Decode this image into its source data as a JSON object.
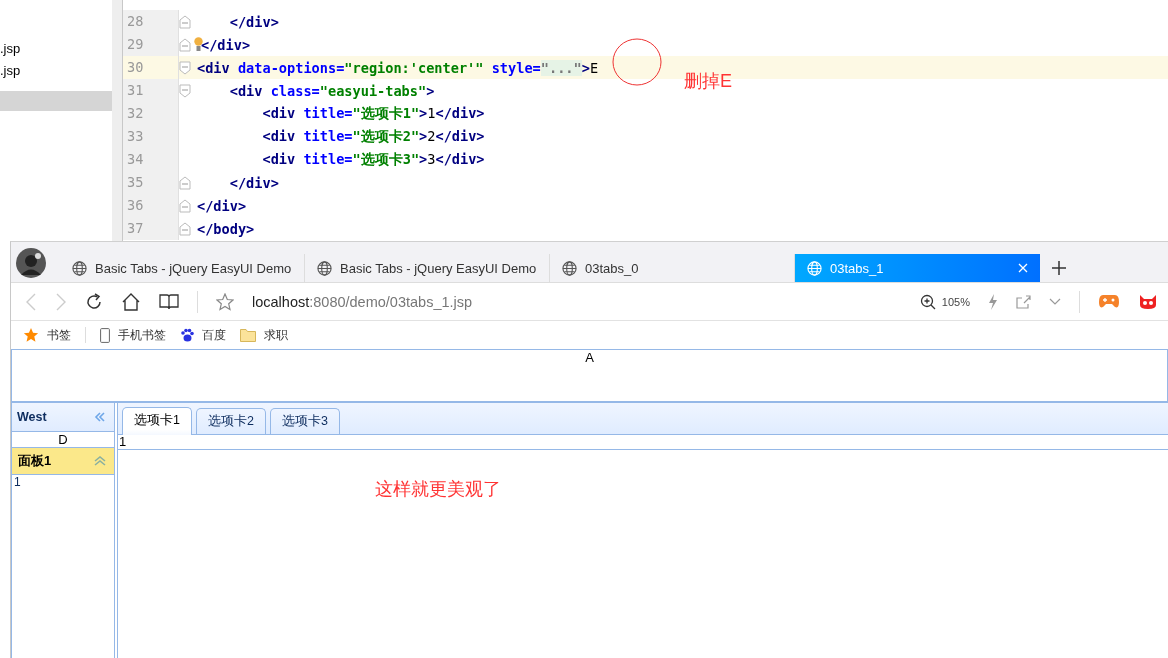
{
  "editor": {
    "files": [
      {
        "name": ".jsp"
      },
      {
        "name": ".jsp"
      }
    ],
    "lines": [
      {
        "number": "28",
        "fold_start": false,
        "fold_end": true,
        "bulb": false,
        "current": false,
        "tokens": [
          {
            "kind": "tag",
            "text": "    </div>"
          }
        ]
      },
      {
        "number": "29",
        "fold_start": false,
        "fold_end": true,
        "bulb": true,
        "current": false,
        "tokens": [
          {
            "kind": "tag",
            "text": "</div>"
          }
        ]
      },
      {
        "number": "30",
        "fold_start": true,
        "fold_end": false,
        "bulb": false,
        "current": true,
        "tokens": [
          {
            "kind": "tag",
            "text": "<div"
          },
          {
            "kind": "attr",
            "text": " data-options="
          },
          {
            "kind": "str",
            "text": "\"region:'center'\""
          },
          {
            "kind": "attr",
            "text": " style="
          },
          {
            "kind": "folded",
            "text": "\"...\""
          },
          {
            "kind": "tag",
            "text": ">"
          },
          {
            "kind": "text",
            "text": "E"
          }
        ]
      },
      {
        "number": "31",
        "fold_start": true,
        "fold_end": false,
        "bulb": false,
        "current": false,
        "tokens": [
          {
            "kind": "tag",
            "text": "    <div"
          },
          {
            "kind": "attr",
            "text": " class="
          },
          {
            "kind": "str",
            "text": "\"easyui-tabs\""
          },
          {
            "kind": "tag",
            "text": ">"
          }
        ]
      },
      {
        "number": "32",
        "fold_start": false,
        "fold_end": false,
        "bulb": false,
        "current": false,
        "tokens": [
          {
            "kind": "tag",
            "text": "        <div"
          },
          {
            "kind": "attr",
            "text": " title="
          },
          {
            "kind": "str",
            "text": "\"选项卡1\""
          },
          {
            "kind": "tag",
            "text": ">"
          },
          {
            "kind": "text",
            "text": "1"
          },
          {
            "kind": "tag",
            "text": "</div>"
          }
        ]
      },
      {
        "number": "33",
        "fold_start": false,
        "fold_end": false,
        "bulb": false,
        "current": false,
        "tokens": [
          {
            "kind": "tag",
            "text": "        <div"
          },
          {
            "kind": "attr",
            "text": " title="
          },
          {
            "kind": "str",
            "text": "\"选项卡2\""
          },
          {
            "kind": "tag",
            "text": ">"
          },
          {
            "kind": "text",
            "text": "2"
          },
          {
            "kind": "tag",
            "text": "</div>"
          }
        ]
      },
      {
        "number": "34",
        "fold_start": false,
        "fold_end": false,
        "bulb": false,
        "current": false,
        "tokens": [
          {
            "kind": "tag",
            "text": "        <div"
          },
          {
            "kind": "attr",
            "text": " title="
          },
          {
            "kind": "str",
            "text": "\"选项卡3\""
          },
          {
            "kind": "tag",
            "text": ">"
          },
          {
            "kind": "text",
            "text": "3"
          },
          {
            "kind": "tag",
            "text": "</div>"
          }
        ]
      },
      {
        "number": "35",
        "fold_start": false,
        "fold_end": true,
        "bulb": false,
        "current": false,
        "tokens": [
          {
            "kind": "tag",
            "text": "    </div>"
          }
        ]
      },
      {
        "number": "36",
        "fold_start": false,
        "fold_end": true,
        "bulb": false,
        "current": false,
        "tokens": [
          {
            "kind": "tag",
            "text": "</div>"
          }
        ]
      },
      {
        "number": "37",
        "fold_start": false,
        "fold_end": true,
        "bulb": false,
        "current": false,
        "tokens": [
          {
            "kind": "tag",
            "text": "</body>"
          }
        ]
      }
    ],
    "annotation": "删掉E"
  },
  "browser": {
    "tabs": [
      {
        "title": "Basic Tabs - jQuery EasyUI Demo",
        "selected": false
      },
      {
        "title": "Basic Tabs - jQuery EasyUI Demo",
        "selected": false
      },
      {
        "title": "03tabs_0",
        "selected": false
      },
      {
        "title": "03tabs_1",
        "selected": true
      }
    ],
    "url_host": "localhost",
    "url_rest": ":8080/demo/03tabs_1.jsp",
    "zoom": "105%",
    "bookmarks": [
      {
        "kind": "star",
        "label": "书签"
      },
      {
        "kind": "phone",
        "label": "手机书签"
      },
      {
        "kind": "paw",
        "label": "百度"
      },
      {
        "kind": "folder",
        "label": "求职"
      }
    ]
  },
  "page": {
    "north": "A",
    "west": {
      "title": "West",
      "row": "D",
      "accordion": [
        {
          "title": "面板1",
          "expanded": true,
          "content": "1"
        }
      ]
    },
    "tabs": [
      {
        "label": "选项卡1",
        "selected": true
      },
      {
        "label": "选项卡2",
        "selected": false
      },
      {
        "label": "选项卡3",
        "selected": false
      }
    ],
    "tab_content": "1",
    "note": "这样就更美观了"
  }
}
